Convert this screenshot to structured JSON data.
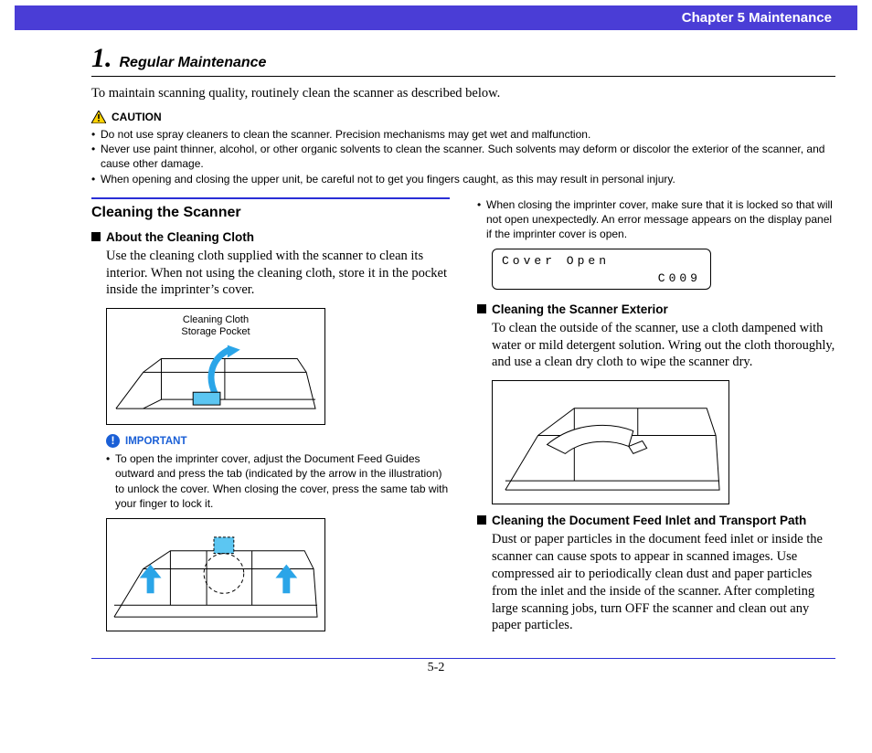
{
  "chapter_banner": "Chapter 5   Maintenance",
  "section": {
    "number": "1.",
    "title": "Regular Maintenance"
  },
  "intro": "To maintain scanning quality, routinely clean the scanner as described below.",
  "caution": {
    "label": "CAUTION",
    "items": [
      "Do not use spray cleaners to clean the scanner. Precision mechanisms may get wet and malfunction.",
      "Never use paint thinner, alcohol, or other organic solvents to clean the scanner. Such solvents may deform or discolor the exterior of the scanner, and cause other damage.",
      "When opening and closing the upper unit, be careful not to get you fingers caught, as this may result in personal injury."
    ]
  },
  "left": {
    "h2": "Cleaning the Scanner",
    "sub1": {
      "title": "About the Cleaning Cloth",
      "body": "Use the cleaning cloth supplied with the scanner to clean its interior. When not using the cleaning cloth, store it in the pocket inside the imprinter’s cover.",
      "fig_label": "Cleaning Cloth\nStorage Pocket"
    },
    "important": {
      "label": "IMPORTANT",
      "items": [
        "To open the imprinter cover, adjust the Document Feed Guides outward and press the tab (indicated by the arrow in the illustration) to unlock the cover. When closing the cover, press the same tab with your finger to lock it."
      ]
    }
  },
  "right": {
    "top_items": [
      "When closing the imprinter cover, make sure that it is locked so that will not open unexpectedly. An error message appears on the display panel if the imprinter cover is open."
    ],
    "display": {
      "line1": "Cover Open",
      "line2": "C009"
    },
    "sub2": {
      "title": "Cleaning the Scanner Exterior",
      "body": "To clean the outside of the scanner, use a cloth dampened with water or mild detergent solution. Wring out the cloth thoroughly, and use a clean dry cloth to wipe the scanner dry."
    },
    "sub3": {
      "title": "Cleaning the Document Feed Inlet and Transport Path",
      "body": "Dust or paper particles in the document feed inlet or inside the scanner can cause spots to appear in scanned images. Use compressed air to periodically clean dust and paper particles from the inlet and the inside of the scanner. After completing large scanning jobs, turn OFF the scanner and clean out any paper particles."
    }
  },
  "page_number": "5-2"
}
